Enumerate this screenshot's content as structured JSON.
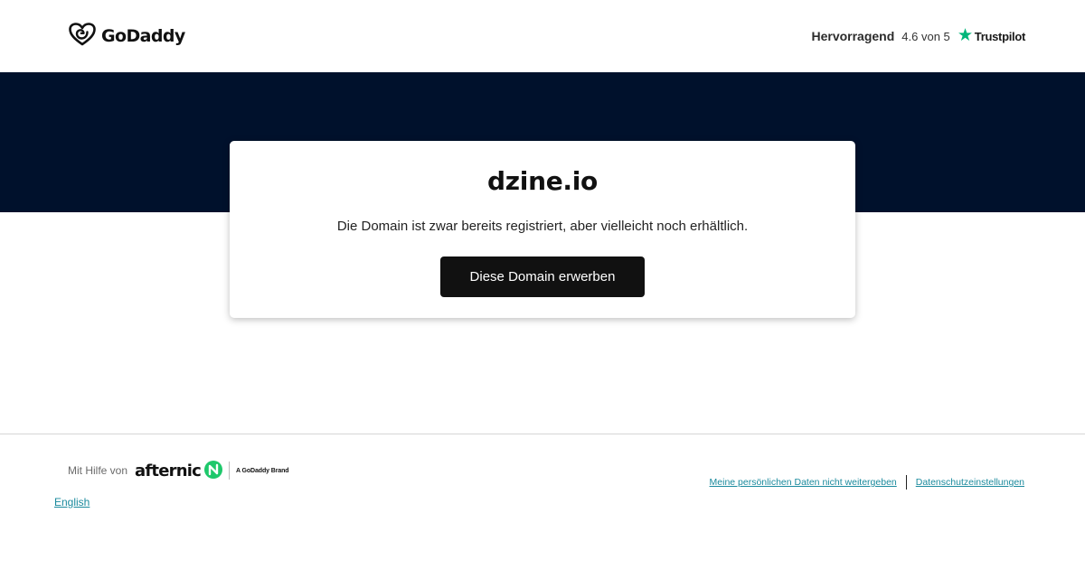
{
  "header": {
    "logo_text": "GoDaddy",
    "rating": {
      "label": "Hervorragend",
      "score_text": "4.6 von 5",
      "provider": "Trustpilot",
      "star_color": "#00b67a"
    }
  },
  "colors": {
    "band": "#00112c",
    "button_bg": "#111111",
    "link": "#1a8a9d",
    "afternic_green": "#1ec86b"
  },
  "card": {
    "domain": "dzine.io",
    "message": "Die Domain ist zwar bereits registriert, aber vielleicht noch erhältlich.",
    "button_label": "Diese Domain erwerben"
  },
  "footer": {
    "helped_by": "Mit Hilfe von",
    "afternic_text": "afternic",
    "brand_tag": "A GoDaddy Brand",
    "language_link": "English",
    "links": [
      "Meine persönlichen Daten nicht weitergeben",
      "Datenschutzeinstellungen"
    ]
  },
  "icons": {
    "logo": "godaddy-heart-icon",
    "star": "trustpilot-star-icon",
    "afternic_mark": "afternic-mark-icon"
  }
}
